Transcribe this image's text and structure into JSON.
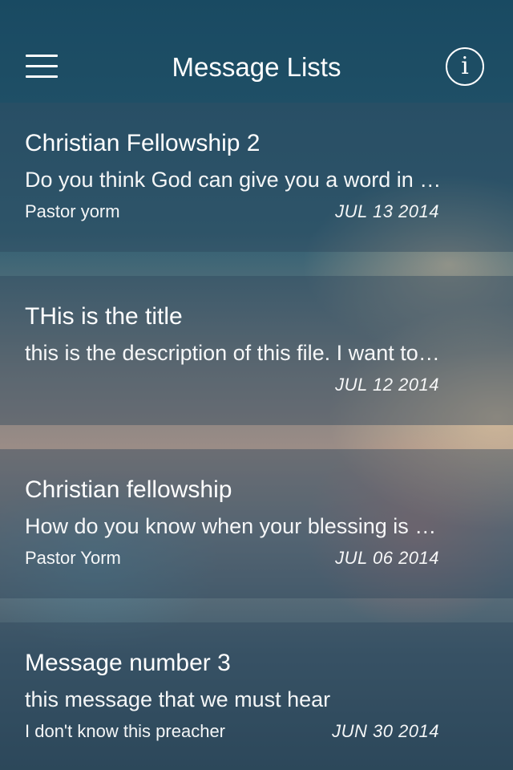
{
  "header": {
    "title": "Message Lists",
    "menu_icon": "hamburger-menu-icon",
    "info_icon": "info-icon",
    "info_glyph": "i"
  },
  "messages": [
    {
      "title": "Christian Fellowship 2",
      "description": "Do you think God can give you a word in season",
      "author": "Pastor yorm",
      "date": "JUL 13 2014"
    },
    {
      "title": "THis is the title",
      "description": "this is the description of this file. I want to see",
      "author": "",
      "date": "JUL 12 2014"
    },
    {
      "title": "Christian fellowship",
      "description": "How do you know when your blessing is coming",
      "author": "Pastor Yorm",
      "date": "JUL 06 2014"
    },
    {
      "title": "Message number 3",
      "description": "this message that we must hear",
      "author": "I don't know this preacher",
      "date": "JUN 30 2014"
    }
  ],
  "colors": {
    "text": "#ffffff",
    "nav_background": "#1d4f68"
  }
}
